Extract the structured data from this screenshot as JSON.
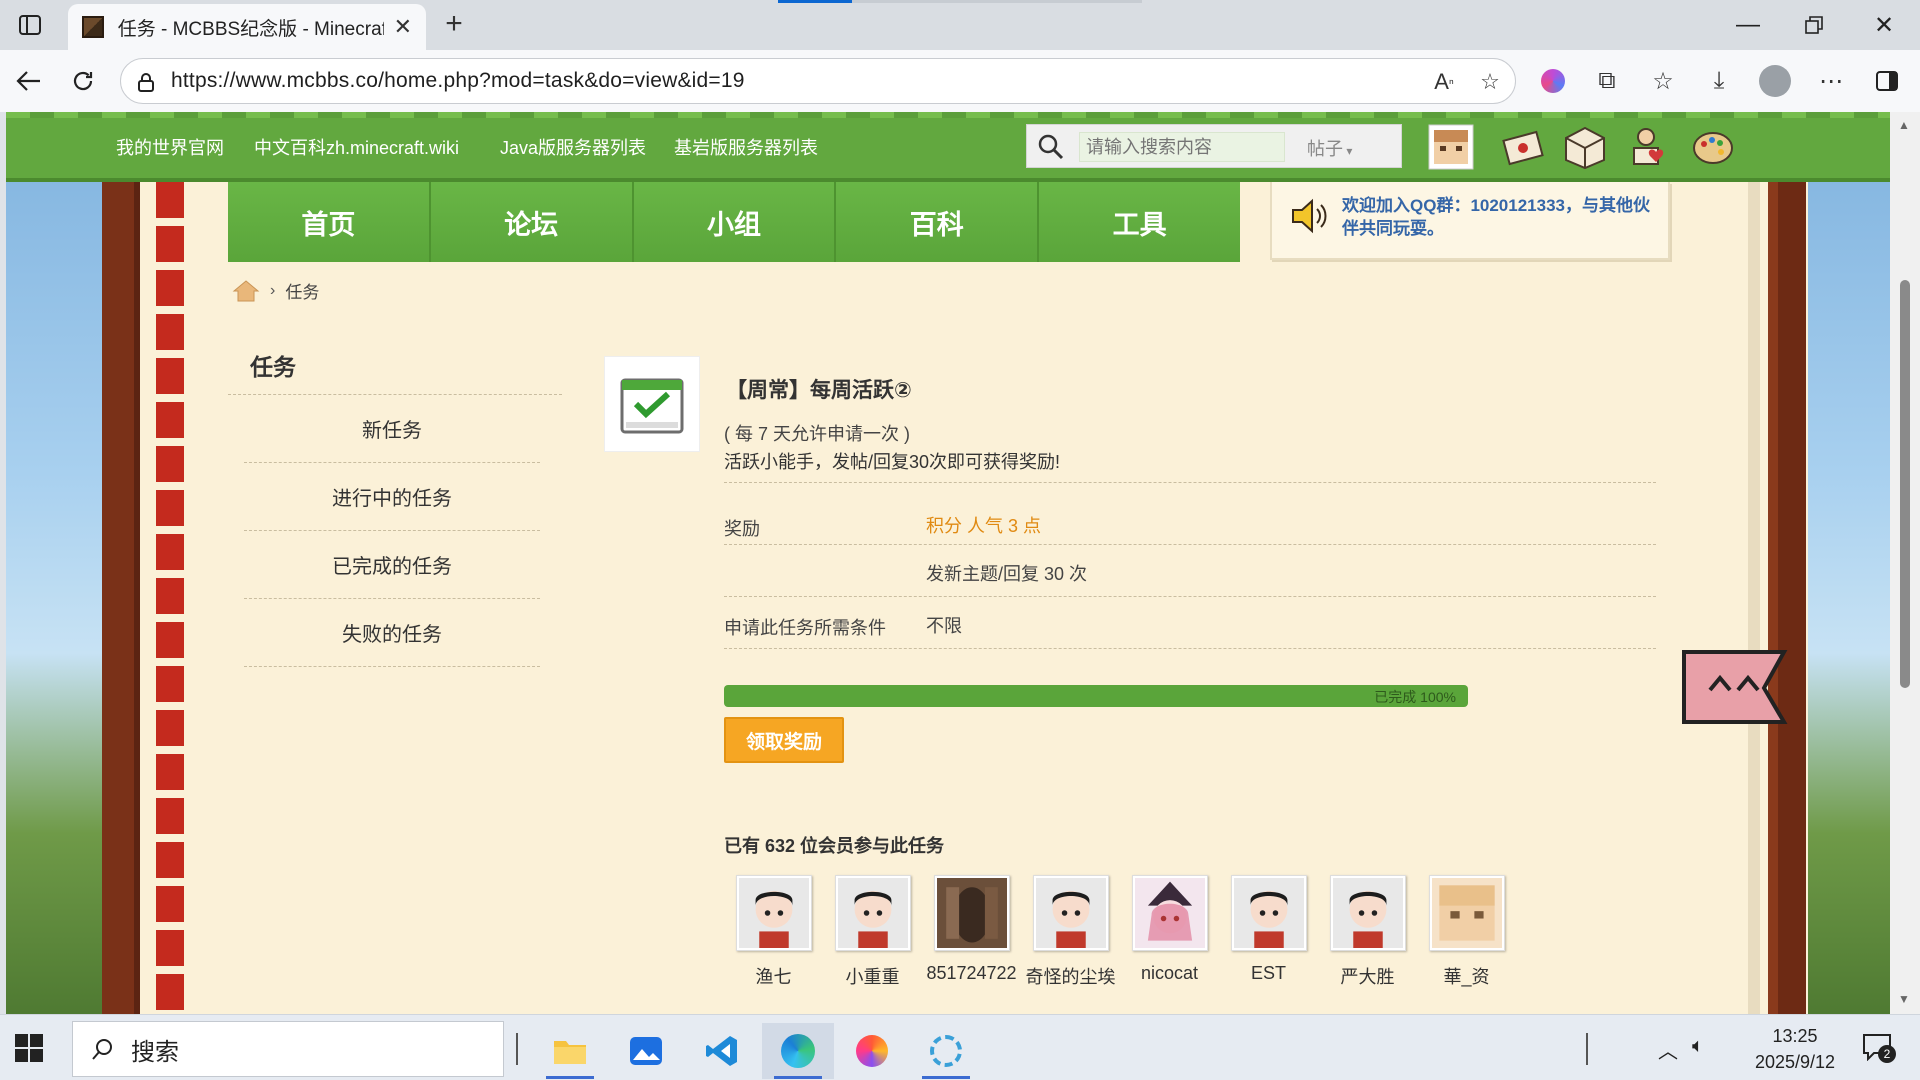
{
  "browser": {
    "tab_title": "任务 - MCBBS纪念版 - Minecraft(我的世界)中文论坛",
    "url": "https://www.mcbbs.co/home.php?mod=task&do=view&id=19"
  },
  "site": {
    "top_links": [
      "我的世界官网",
      "中文百科zh.minecraft.wiki",
      "Java版服务器列表",
      "基岩版服务器列表"
    ],
    "search_placeholder": "请输入搜索内容",
    "search_type": "帖子",
    "nav": [
      "首页",
      "论坛",
      "小组",
      "百科",
      "工具"
    ],
    "notice": "欢迎加入QQ群：1020121333，与其他伙伴共同玩耍。"
  },
  "breadcrumb": {
    "current": "任务"
  },
  "sidebar": {
    "title": "任务",
    "items": [
      "新任务",
      "进行中的任务",
      "已完成的任务",
      "失败的任务"
    ]
  },
  "task": {
    "title": "【周常】每周活跃②",
    "frequency": "( 每 7 天允许申请一次 )",
    "description": "活跃小能手，发帖/回复30次即可获得奖励!",
    "reward_label": "奖励",
    "reward_value": "积分 人气 3 点",
    "requirement_value": "发新主题/回复 30 次",
    "condition_label": "申请此任务所需条件",
    "condition_value": "不限",
    "progress_percent": 100,
    "progress_label": "已完成 100%",
    "claim_button": "领取奖励",
    "members_heading": "已有 632 位会员参与此任务",
    "members": [
      "渔七",
      "小重重",
      "851724722",
      "奇怪的尘埃",
      "nicocat",
      "EST",
      "严大胜",
      "華_资"
    ]
  },
  "taskbar": {
    "search_text": "搜索",
    "time": "13:25",
    "date": "2025/9/12",
    "notification_count": "2"
  }
}
